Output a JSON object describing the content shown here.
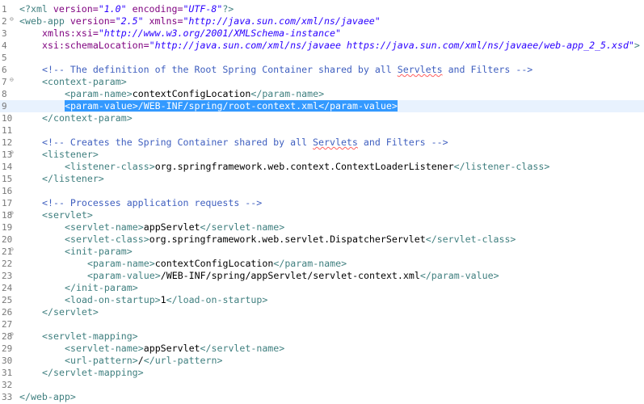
{
  "colors": {
    "tag": "#3f7f7f",
    "attribute": "#7f007f",
    "attribute_value": "#2a00ff",
    "text": "#000000",
    "comment": "#3f5fbf",
    "selection": "#3399ff",
    "current_line": "#e8f2fe",
    "line_number": "#787878"
  },
  "editor": {
    "fold_glyph": "⊖",
    "lines": [
      {
        "num": "1",
        "fold": false,
        "indent": 0,
        "parts": [
          {
            "t": "tag",
            "v": "<?xml "
          },
          {
            "t": "attr",
            "v": "version="
          },
          {
            "t": "val",
            "v": "\"1.0\""
          },
          {
            "t": "attr",
            "v": " encoding="
          },
          {
            "t": "val",
            "v": "\"UTF-8\""
          },
          {
            "t": "tag",
            "v": "?>"
          }
        ]
      },
      {
        "num": "2",
        "fold": true,
        "indent": 0,
        "parts": [
          {
            "t": "tag",
            "v": "<web-app "
          },
          {
            "t": "attr",
            "v": "version="
          },
          {
            "t": "val",
            "v": "\"2.5\""
          },
          {
            "t": "attr",
            "v": " xmlns="
          },
          {
            "t": "val",
            "v": "\"http://java.sun.com/xml/ns/javaee\""
          }
        ]
      },
      {
        "num": "3",
        "fold": false,
        "indent": 1,
        "parts": [
          {
            "t": "attr",
            "v": "xmlns:xsi="
          },
          {
            "t": "val",
            "v": "\"http://www.w3.org/2001/XMLSchema-instance\""
          }
        ]
      },
      {
        "num": "4",
        "fold": false,
        "indent": 1,
        "parts": [
          {
            "t": "attr",
            "v": "xsi:schemaLocation="
          },
          {
            "t": "val",
            "v": "\"http://java.sun.com/xml/ns/javaee https://java.sun.com/xml/ns/javaee/web-app_2_5.xsd\""
          },
          {
            "t": "tag",
            "v": ">"
          }
        ]
      },
      {
        "num": "5",
        "fold": false,
        "indent": 0,
        "parts": []
      },
      {
        "num": "6",
        "fold": false,
        "indent": 1,
        "parts": [
          {
            "t": "cmt",
            "v": "<!-- The definition of the Root Spring Container shared by all "
          },
          {
            "t": "squig",
            "v": "Servlets"
          },
          {
            "t": "cmt",
            "v": " and Filters -->"
          }
        ]
      },
      {
        "num": "7",
        "fold": true,
        "indent": 1,
        "parts": [
          {
            "t": "tag",
            "v": "<context-param>"
          }
        ]
      },
      {
        "num": "8",
        "fold": false,
        "indent": 2,
        "parts": [
          {
            "t": "tag",
            "v": "<param-name>"
          },
          {
            "t": "text",
            "v": "contextConfigLocation"
          },
          {
            "t": "tag",
            "v": "</param-name>"
          }
        ]
      },
      {
        "num": "9",
        "fold": false,
        "indent": 2,
        "current": true,
        "parts": [
          {
            "t": "sel",
            "v": "<param-value>/WEB-INF/spring/root-context.xml</param-value>"
          }
        ]
      },
      {
        "num": "10",
        "fold": false,
        "indent": 1,
        "parts": [
          {
            "t": "tag",
            "v": "</context-param>"
          }
        ]
      },
      {
        "num": "11",
        "fold": false,
        "indent": 0,
        "parts": []
      },
      {
        "num": "12",
        "fold": false,
        "indent": 1,
        "parts": [
          {
            "t": "cmt",
            "v": "<!-- Creates the Spring Container shared by all "
          },
          {
            "t": "squig",
            "v": "Servlets"
          },
          {
            "t": "cmt",
            "v": " and Filters -->"
          }
        ]
      },
      {
        "num": "13",
        "fold": true,
        "indent": 1,
        "parts": [
          {
            "t": "tag",
            "v": "<listener>"
          }
        ]
      },
      {
        "num": "14",
        "fold": false,
        "indent": 2,
        "parts": [
          {
            "t": "tag",
            "v": "<listener-class>"
          },
          {
            "t": "text",
            "v": "org.springframework.web.context.ContextLoaderListener"
          },
          {
            "t": "tag",
            "v": "</listener-class>"
          }
        ]
      },
      {
        "num": "15",
        "fold": false,
        "indent": 1,
        "parts": [
          {
            "t": "tag",
            "v": "</listener>"
          }
        ]
      },
      {
        "num": "16",
        "fold": false,
        "indent": 0,
        "parts": []
      },
      {
        "num": "17",
        "fold": false,
        "indent": 1,
        "parts": [
          {
            "t": "cmt",
            "v": "<!-- Processes application requests -->"
          }
        ]
      },
      {
        "num": "18",
        "fold": true,
        "indent": 1,
        "parts": [
          {
            "t": "tag",
            "v": "<servlet>"
          }
        ]
      },
      {
        "num": "19",
        "fold": false,
        "indent": 2,
        "parts": [
          {
            "t": "tag",
            "v": "<servlet-name>"
          },
          {
            "t": "text",
            "v": "appServlet"
          },
          {
            "t": "tag",
            "v": "</servlet-name>"
          }
        ]
      },
      {
        "num": "20",
        "fold": false,
        "indent": 2,
        "parts": [
          {
            "t": "tag",
            "v": "<servlet-class>"
          },
          {
            "t": "text",
            "v": "org.springframework.web.servlet.DispatcherServlet"
          },
          {
            "t": "tag",
            "v": "</servlet-class>"
          }
        ]
      },
      {
        "num": "21",
        "fold": true,
        "indent": 2,
        "parts": [
          {
            "t": "tag",
            "v": "<init-param>"
          }
        ]
      },
      {
        "num": "22",
        "fold": false,
        "indent": 3,
        "parts": [
          {
            "t": "tag",
            "v": "<param-name>"
          },
          {
            "t": "text",
            "v": "contextConfigLocation"
          },
          {
            "t": "tag",
            "v": "</param-name>"
          }
        ]
      },
      {
        "num": "23",
        "fold": false,
        "indent": 3,
        "parts": [
          {
            "t": "tag",
            "v": "<param-value>"
          },
          {
            "t": "text",
            "v": "/WEB-INF/spring/appServlet/servlet-context.xml"
          },
          {
            "t": "tag",
            "v": "</param-value>"
          }
        ]
      },
      {
        "num": "24",
        "fold": false,
        "indent": 2,
        "parts": [
          {
            "t": "tag",
            "v": "</init-param>"
          }
        ]
      },
      {
        "num": "25",
        "fold": false,
        "indent": 2,
        "parts": [
          {
            "t": "tag",
            "v": "<load-on-startup>"
          },
          {
            "t": "text",
            "v": "1"
          },
          {
            "t": "tag",
            "v": "</load-on-startup>"
          }
        ]
      },
      {
        "num": "26",
        "fold": false,
        "indent": 1,
        "parts": [
          {
            "t": "tag",
            "v": "</servlet>"
          }
        ]
      },
      {
        "num": "27",
        "fold": false,
        "indent": 0,
        "parts": []
      },
      {
        "num": "28",
        "fold": true,
        "indent": 1,
        "parts": [
          {
            "t": "tag",
            "v": "<servlet-mapping>"
          }
        ]
      },
      {
        "num": "29",
        "fold": false,
        "indent": 2,
        "parts": [
          {
            "t": "tag",
            "v": "<servlet-name>"
          },
          {
            "t": "text",
            "v": "appServlet"
          },
          {
            "t": "tag",
            "v": "</servlet-name>"
          }
        ]
      },
      {
        "num": "30",
        "fold": false,
        "indent": 2,
        "parts": [
          {
            "t": "tag",
            "v": "<url-pattern>"
          },
          {
            "t": "text",
            "v": "/"
          },
          {
            "t": "tag",
            "v": "</url-pattern>"
          }
        ]
      },
      {
        "num": "31",
        "fold": false,
        "indent": 1,
        "parts": [
          {
            "t": "tag",
            "v": "</servlet-mapping>"
          }
        ]
      },
      {
        "num": "32",
        "fold": false,
        "indent": 0,
        "parts": []
      },
      {
        "num": "33",
        "fold": false,
        "indent": 0,
        "parts": [
          {
            "t": "tag",
            "v": "</web-app>"
          }
        ]
      }
    ]
  }
}
